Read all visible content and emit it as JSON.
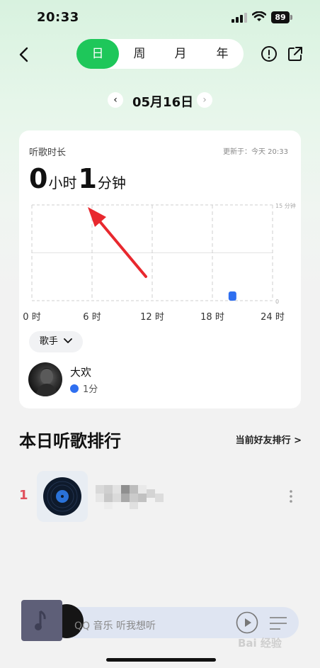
{
  "status": {
    "time": "20:33",
    "battery": "89"
  },
  "nav": {
    "tabs": [
      {
        "label": "日",
        "active": true
      },
      {
        "label": "周",
        "active": false
      },
      {
        "label": "月",
        "active": false
      },
      {
        "label": "年",
        "active": false
      }
    ],
    "back_icon": "chevron-left-icon",
    "info_icon": "exclamation-circle-icon",
    "share_icon": "share-icon"
  },
  "date": {
    "label": "05月16日",
    "prev": "‹",
    "next": "›"
  },
  "card": {
    "title": "听歌时长",
    "updated": "更新于：今天 20:33",
    "hours": "0",
    "hours_unit": "小时",
    "minutes": "1",
    "minutes_unit": "分钟",
    "chip": "歌手",
    "artist": {
      "name": "大欢",
      "time": "1分"
    }
  },
  "chart_data": {
    "type": "bar",
    "x_ticks": [
      "0 时",
      "6 时",
      "12 时",
      "18 时",
      "24 时"
    ],
    "y_top_label": "15 分钟",
    "y_bottom_label": "0",
    "ylim": [
      0,
      15
    ],
    "xlim": [
      0,
      24
    ],
    "bars": [
      {
        "hour": 20,
        "value": 1
      }
    ],
    "bar_color": "#2f6ff0",
    "grid": true
  },
  "ranking": {
    "title": "本日听歌排行",
    "friends_link": "当前好友排行 >",
    "items": [
      {
        "rank": "1"
      }
    ]
  },
  "mini_player": {
    "text": "QQ 音乐 听我想听"
  },
  "watermark": "Bai 经验"
}
